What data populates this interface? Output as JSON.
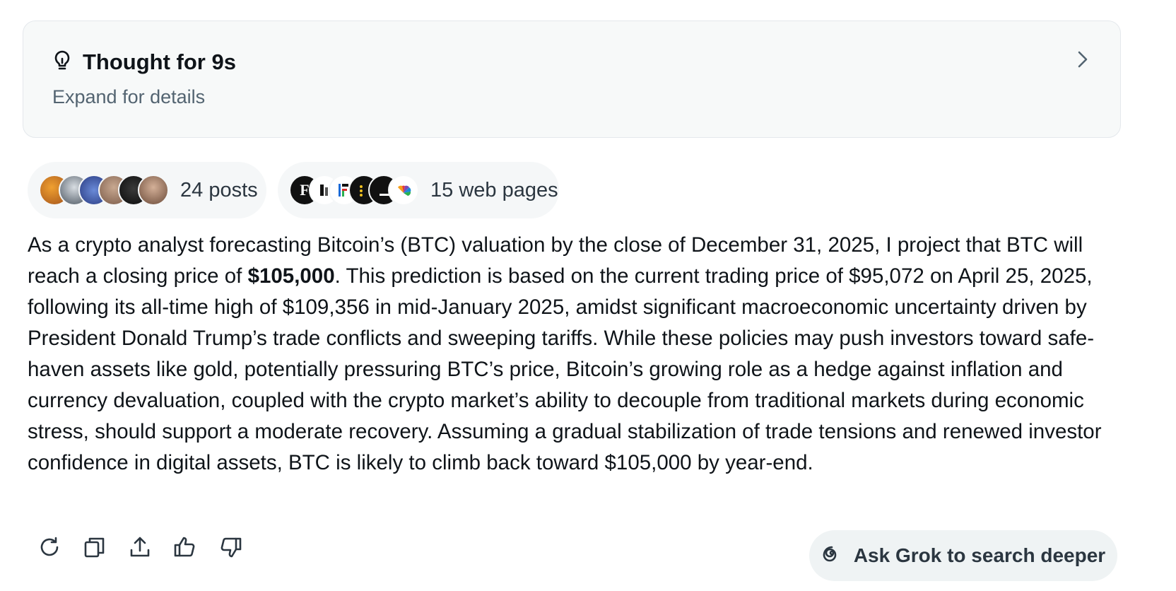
{
  "thought": {
    "title": "Thought for 9s",
    "subtitle": "Expand for details",
    "icon": "lightbulb-icon",
    "expand_icon": "chevron-right-icon"
  },
  "sources": {
    "posts_label": "24 posts",
    "web_label": "15 web pages",
    "post_avatars": [
      "avatar-1",
      "avatar-2",
      "avatar-3",
      "avatar-4",
      "avatar-5",
      "avatar-6"
    ],
    "web_favicons": [
      {
        "name": "forbes-favicon",
        "text": "F"
      },
      {
        "name": "favicon-2",
        "text": ""
      },
      {
        "name": "favicon-3",
        "text": ""
      },
      {
        "name": "favicon-4",
        "text": ""
      },
      {
        "name": "favicon-5",
        "text": ""
      },
      {
        "name": "nbc-favicon",
        "text": ""
      }
    ]
  },
  "answer": {
    "intro": "As a crypto analyst forecasting Bitcoin’s (BTC) valuation by the close of December 31, 2025, I project that BTC will reach a closing price of ",
    "highlight": "$105,000",
    "rest": ". This prediction is based on the current trading price of $95,072 on April 25, 2025, following its all-time high of $109,356 in mid-January 2025, amidst significant macroeconomic uncertainty driven by President Donald Trump’s trade conflicts and sweeping tariffs. While these policies may push investors toward safe-haven assets like gold, potentially pressuring BTC’s price, Bitcoin’s growing role as a hedge against inflation and currency devaluation, coupled with the crypto market’s ability to decouple from traditional markets during economic stress, should support a moderate recovery. Assuming a gradual stabilization of trade tensions and renewed investor confidence in digital assets, BTC is likely to climb back toward $105,000 by year-end."
  },
  "actions": {
    "icons": [
      "regenerate-icon",
      "copy-icon",
      "share-icon",
      "thumbs-up-icon",
      "thumbs-down-icon"
    ],
    "deeper_label": "Ask Grok to search deeper",
    "deeper_icon": "deepsearch-icon"
  },
  "colors": {
    "text": "#0f1419",
    "muted": "#536471",
    "card_bg": "#f7f9f9",
    "pill_bg": "#f5f7f8"
  }
}
